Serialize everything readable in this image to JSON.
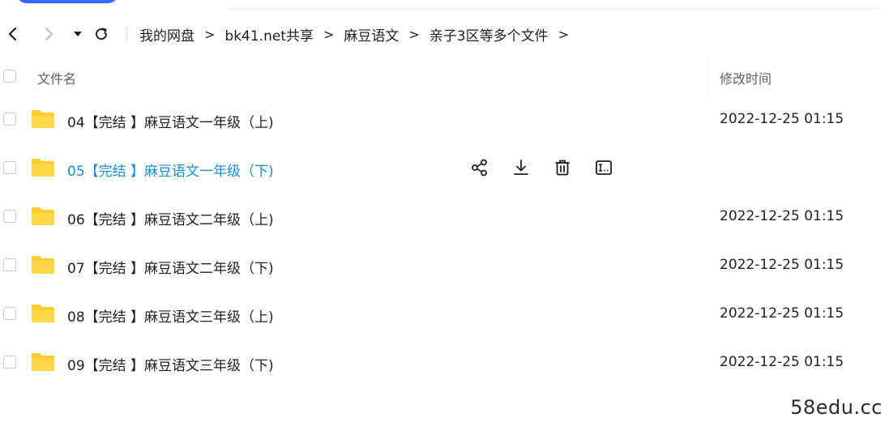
{
  "breadcrumb": {
    "items": [
      "我的网盘",
      "bk41.net共享",
      "麻豆语文",
      "亲子3区等多个文件"
    ],
    "separator": ">"
  },
  "header": {
    "name_col": "文件名",
    "time_col": "修改时间"
  },
  "files": [
    {
      "name": "04【完结 】麻豆语文一年级（上)",
      "time": "2022-12-25 01:15"
    },
    {
      "name": "05【完结 】麻豆语文一年级（下)",
      "time": ""
    },
    {
      "name": "06【完结 】麻豆语文二年级（上)",
      "time": "2022-12-25 01:15"
    },
    {
      "name": "07【完结 】麻豆语文二年级（下)",
      "time": "2022-12-25 01:15"
    },
    {
      "name": "08【完结 】麻豆语文三年级（上)",
      "time": "2022-12-25 01:15"
    },
    {
      "name": "09【完结 】麻豆语文三年级（下)",
      "time": "2022-12-25 01:15"
    }
  ],
  "hover_row_index": 1,
  "row_actions": [
    "share-icon",
    "download-icon",
    "delete-icon",
    "rename-icon"
  ],
  "icons": {
    "back": "chevron-left-icon",
    "forward": "chevron-right-icon",
    "dropdown": "caret-down-icon",
    "refresh": "refresh-icon",
    "folder": "folder-icon"
  },
  "colors": {
    "folder": "#ffcb2f",
    "hover_text": "#1a8fd6",
    "accent": "#2f6bff"
  },
  "watermark": "58edu.cc"
}
